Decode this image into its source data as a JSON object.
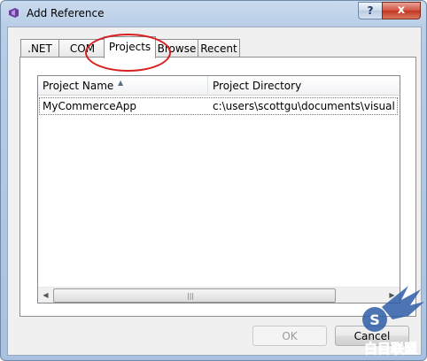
{
  "window": {
    "title": "Add Reference",
    "help_glyph": "?",
    "close_glyph": "x"
  },
  "tabs": [
    {
      "label": ".NET"
    },
    {
      "label": "COM"
    },
    {
      "label": "Projects",
      "selected": true
    },
    {
      "label": "Browse"
    },
    {
      "label": "Recent"
    }
  ],
  "list": {
    "columns": [
      "Project Name",
      "Project Directory"
    ],
    "sorted_column": "Project Name",
    "sort_direction": "ascending",
    "rows": [
      {
        "name": "MyCommerceApp",
        "directory": "c:\\users\\scottgu\\documents\\visual stud"
      }
    ],
    "scroll_grip": "|||"
  },
  "buttons": {
    "ok": "OK",
    "ok_enabled": false,
    "cancel": "Cancel"
  },
  "watermark": {
    "letter": "S",
    "text": "白目联盟"
  },
  "colors": {
    "annotation": "#d81f1f",
    "watermark": "#2e5ea8"
  }
}
